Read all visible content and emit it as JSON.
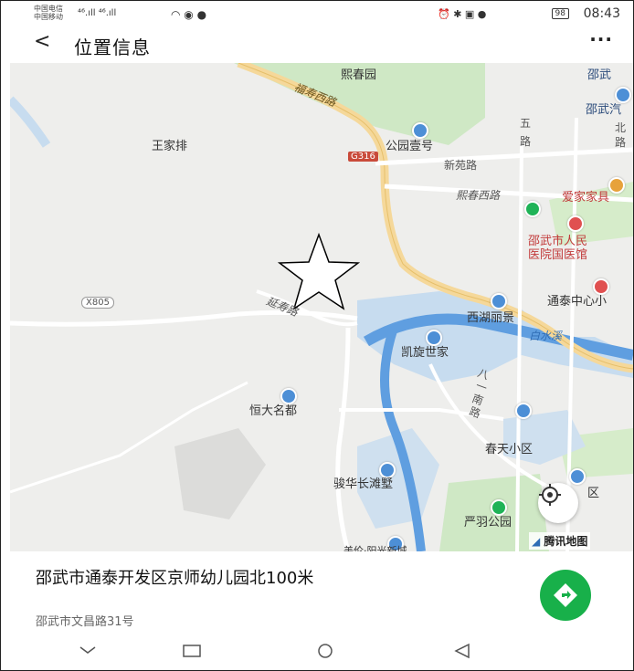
{
  "status_bar": {
    "carrier_1": "中国电信",
    "carrier_2": "中国移动",
    "signal_text": "⁴⁶.ıll ⁴⁶.ıll",
    "battery": "98",
    "time": "08:43"
  },
  "title_bar": {
    "back_glyph": "<",
    "title": "位置信息",
    "more_glyph": "···"
  },
  "map": {
    "pois": {
      "xichun_park": "熙春园",
      "shaowu_top": "邵武",
      "shaowu_qi": "邵武汽",
      "wang_jia_pai": "王家排",
      "gongyuan_yihao": "公园壹号",
      "xinyuan_rd": "新苑路",
      "xichun_west_rd": "熙春西路",
      "aijia": "爱家家具",
      "hospital_1": "邵武市人民",
      "hospital_2": "医院国医馆",
      "tongtai_center": "通泰中心小",
      "xihu_lijing": "西湖丽景",
      "kaixuan": "凯旋世家",
      "baishui_creek": "白水溪",
      "hengda": "恒大名都",
      "chuntian": "春天小区",
      "junhua": "骏华长滩墅",
      "qu": "区",
      "yanyu_park": "严羽公园",
      "bottom_cut": "美伦·阳光新城"
    },
    "roads": {
      "fushou_west": "福寿西路",
      "wu_lu_1": "五",
      "wu_lu_2": "路",
      "bei_lu_1": "北",
      "bei_lu_2": "路",
      "g316": "G316",
      "x805": "X805",
      "yan_lu": "延寿路",
      "ba_yi_1": "八",
      "ba_yi_2": "一",
      "ba_yi_3": "南",
      "ba_yi_4": "路"
    },
    "logo": "腾讯地图"
  },
  "info": {
    "place_name": "邵武市通泰开发区京师幼儿园北100米",
    "address": "邵武市文昌路31号"
  },
  "colors": {
    "map_bg": "#eeeeec",
    "park": "#cfe8c5",
    "water": "#c7dcef",
    "river": "#5f9ee0",
    "road_major": "#f5d89a",
    "nav_green": "#18b04a"
  },
  "icons": {
    "star": "star-outline-icon",
    "locate": "locate-target-icon",
    "navigate": "navigate-diamond-icon"
  }
}
